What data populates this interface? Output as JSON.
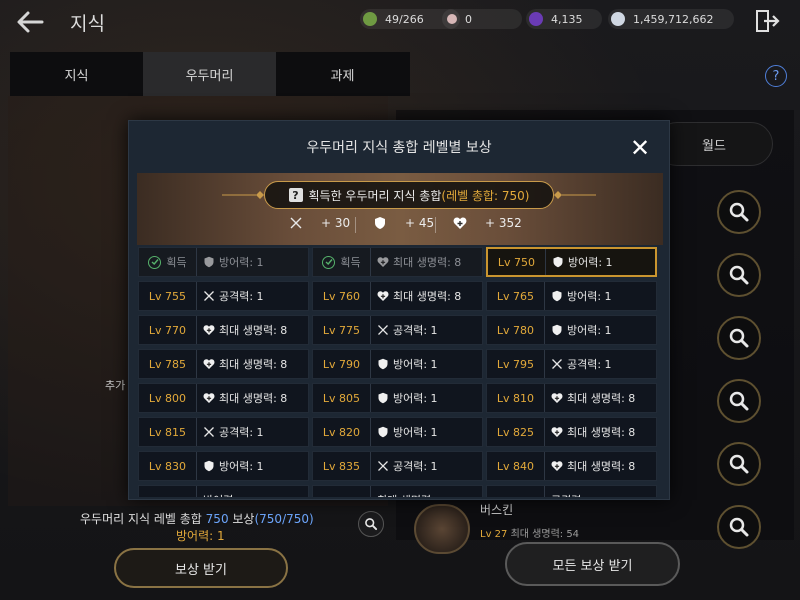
{
  "header": {
    "title": "지식",
    "resources": [
      {
        "name": "currency-1",
        "value": "49/266",
        "color": "#6f9a42"
      },
      {
        "name": "currency-2",
        "value": "0",
        "color": "#d7b7b7"
      },
      {
        "name": "currency-3",
        "value": "4,135",
        "color": "#6a3bb5"
      },
      {
        "name": "currency-4",
        "value": "1,459,712,662",
        "color": "#cfd7e2"
      }
    ]
  },
  "tabs": [
    {
      "label": "지식"
    },
    {
      "label": "우두머리",
      "active": true
    },
    {
      "label": "과제"
    }
  ],
  "help_label": "?",
  "background": {
    "left_text_fragment": "추가",
    "world_label": "월드",
    "total_label_prefix": "우두머리 지식 레벨 총합 ",
    "total_level": "750",
    "total_label_mid": " 보상",
    "total_count": "(750/750)",
    "total_reward": "방어력: 1",
    "book_name": "버스킨",
    "book_sub_level": "Lv 27",
    "book_sub_stat": "최대 생명력: 54",
    "claim_button": "보상 받기",
    "claim_all_button": "모든 보상 받기"
  },
  "modal": {
    "title": "우두머리 지식 총합 레벨별 보상",
    "close_label": "✕",
    "summary": {
      "label": "획득한 우두머리 지식 총합",
      "level_text": "(레벨 총합: 750)",
      "stats": [
        {
          "icon": "sword-icon",
          "value": "+ 30"
        },
        {
          "icon": "shield-icon",
          "value": "+ 45"
        },
        {
          "icon": "heart-icon",
          "value": "+ 352"
        }
      ]
    },
    "rewards": [
      {
        "level": "획득",
        "claimed": true,
        "icon": "shield-icon",
        "stat": "방어력: 1"
      },
      {
        "level": "획득",
        "claimed": true,
        "icon": "heart-icon",
        "stat": "최대 생명력: 8"
      },
      {
        "level": "Lv 750",
        "selected": true,
        "icon": "shield-icon",
        "stat": "방어력: 1"
      },
      {
        "level": "Lv 755",
        "icon": "sword-icon",
        "stat": "공격력: 1"
      },
      {
        "level": "Lv 760",
        "icon": "heart-icon",
        "stat": "최대 생명력: 8"
      },
      {
        "level": "Lv 765",
        "icon": "shield-icon",
        "stat": "방어력: 1"
      },
      {
        "level": "Lv 770",
        "icon": "heart-icon",
        "stat": "최대 생명력: 8"
      },
      {
        "level": "Lv 775",
        "icon": "sword-icon",
        "stat": "공격력: 1"
      },
      {
        "level": "Lv 780",
        "icon": "shield-icon",
        "stat": "방어력: 1"
      },
      {
        "level": "Lv 785",
        "icon": "heart-icon",
        "stat": "최대 생명력: 8"
      },
      {
        "level": "Lv 790",
        "icon": "shield-icon",
        "stat": "방어력: 1"
      },
      {
        "level": "Lv 795",
        "icon": "sword-icon",
        "stat": "공격력: 1"
      },
      {
        "level": "Lv 800",
        "icon": "heart-icon",
        "stat": "최대 생명력: 8"
      },
      {
        "level": "Lv 805",
        "icon": "shield-icon",
        "stat": "방어력: 1"
      },
      {
        "level": "Lv 810",
        "icon": "heart-icon",
        "stat": "최대 생명력: 8"
      },
      {
        "level": "Lv 815",
        "icon": "sword-icon",
        "stat": "공격력: 1"
      },
      {
        "level": "Lv 820",
        "icon": "shield-icon",
        "stat": "방어력: 1"
      },
      {
        "level": "Lv 825",
        "icon": "heart-icon",
        "stat": "최대 생명력: 8"
      },
      {
        "level": "Lv 830",
        "icon": "shield-icon",
        "stat": "방어력: 1"
      },
      {
        "level": "Lv 835",
        "icon": "sword-icon",
        "stat": "공격력: 1"
      },
      {
        "level": "Lv 840",
        "icon": "heart-icon",
        "stat": "최대 생명력: 8"
      },
      {
        "level": "",
        "icon": "",
        "stat": "방어력"
      },
      {
        "level": "",
        "icon": "",
        "stat": "최대 생명력"
      },
      {
        "level": "",
        "icon": "",
        "stat": "공격력"
      }
    ]
  }
}
